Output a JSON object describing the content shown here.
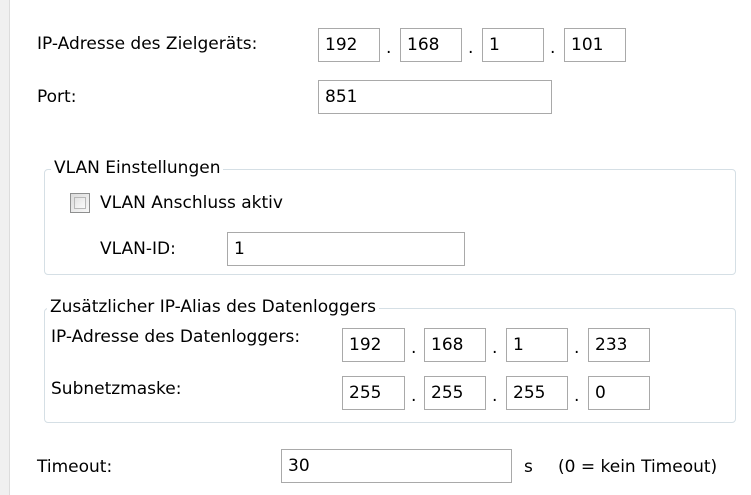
{
  "target": {
    "ip_label": "IP-Adresse des Zielgeräts:",
    "ip": [
      "192",
      "168",
      "1",
      "101"
    ],
    "port_label": "Port:",
    "port": "851"
  },
  "vlan": {
    "title": "VLAN Einstellungen",
    "active_label": "VLAN Anschluss aktiv",
    "active_checked": false,
    "id_label": "VLAN-ID:",
    "id": "1"
  },
  "alias": {
    "title": "Zusätzlicher IP-Alias des Datenloggers",
    "ip_label": "IP-Adresse des Datenloggers:",
    "ip": [
      "192",
      "168",
      "1",
      "233"
    ],
    "mask_label": "Subnetzmaske:",
    "mask": [
      "255",
      "255",
      "255",
      "0"
    ]
  },
  "timeout": {
    "label": "Timeout:",
    "value": "30",
    "unit": "s",
    "hint": "(0 = kein Timeout)"
  },
  "separator": "."
}
